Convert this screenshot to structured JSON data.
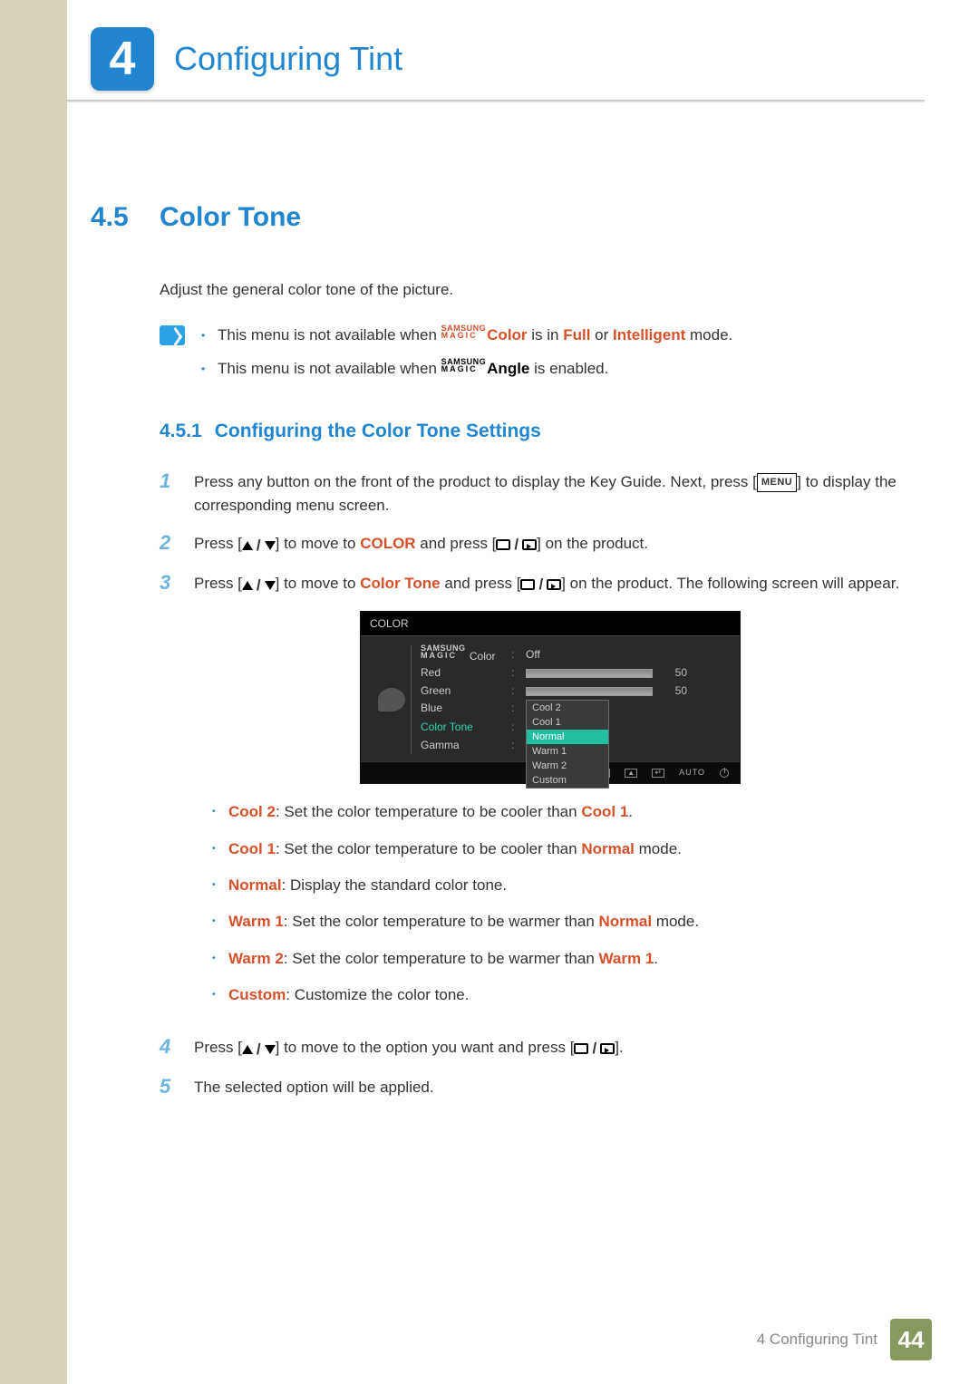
{
  "chapter": {
    "number": "4",
    "title": "Configuring Tint"
  },
  "section": {
    "number": "4.5",
    "title": "Color Tone"
  },
  "intro": "Adjust the general color tone of the picture.",
  "magic_top": "SAMSUNG",
  "magic_bottom": "MAGIC",
  "notes": {
    "n1_a": "This menu is not available when ",
    "n1_b": "Color",
    "n1_c": " is in ",
    "n1_d": "Full",
    "n1_e": " or ",
    "n1_f": "Intelligent",
    "n1_g": " mode.",
    "n2_a": "This menu is not available when ",
    "n2_b": "Angle",
    "n2_c": " is enabled."
  },
  "subsection": {
    "number": "4.5.1",
    "title": "Configuring the Color Tone Settings"
  },
  "steps": {
    "s1_a": "Press any button on the front of the product to display the Key Guide. Next, press [",
    "s1_menu": "MENU",
    "s1_b": "] to display the corresponding menu screen.",
    "s2_a": "Press [",
    "s2_b": "] to move to ",
    "s2_c": "COLOR",
    "s2_d": " and press [",
    "s2_e": "] on the product.",
    "s3_a": "Press [",
    "s3_b": "] to move to ",
    "s3_c": "Color Tone",
    "s3_d": " and press [",
    "s3_e": "] on the product. The following screen will appear.",
    "s4_a": "Press [",
    "s4_b": "] to move to the option you want and press [",
    "s4_c": "].",
    "s5": "The selected option will be applied."
  },
  "osd": {
    "title": "COLOR",
    "magic_label": " Color",
    "magic_val": "Off",
    "red": "Red",
    "red_val": "50",
    "green": "Green",
    "green_val": "50",
    "blue": "Blue",
    "colortone": "Color Tone",
    "gamma": "Gamma",
    "opts": {
      "o1": "Cool 2",
      "o2": "Cool 1",
      "o3": "Normal",
      "o4": "Warm 1",
      "o5": "Warm 2",
      "o6": "Custom"
    },
    "footer_auto": "AUTO"
  },
  "options": {
    "o1_k": "Cool 2",
    "o1_a": ": Set the color temperature to be cooler than ",
    "o1_b": "Cool 1",
    "o1_c": ".",
    "o2_k": "Cool 1",
    "o2_a": ": Set the color temperature to be cooler than ",
    "o2_b": "Normal",
    "o2_c": " mode.",
    "o3_k": "Normal",
    "o3_a": ": Display the standard color tone.",
    "o4_k": "Warm 1",
    "o4_a": ": Set the color temperature to be warmer than ",
    "o4_b": "Normal",
    "o4_c": " mode.",
    "o5_k": "Warm 2",
    "o5_a": ": Set the color temperature to be warmer than ",
    "o5_b": "Warm 1",
    "o5_c": ".",
    "o6_k": "Custom",
    "o6_a": ": Customize the color tone."
  },
  "footer": {
    "text": "4 Configuring Tint",
    "page": "44"
  }
}
